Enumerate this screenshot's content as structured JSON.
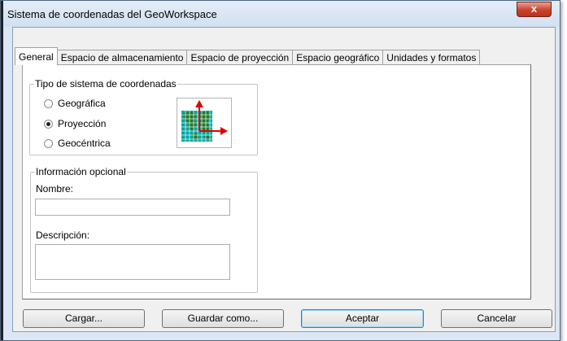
{
  "window": {
    "title": "Sistema de coordenadas del GeoWorkspace",
    "close_symbol": "x"
  },
  "tabs": [
    {
      "label": "General",
      "active": true
    },
    {
      "label": "Espacio de almacenamiento",
      "active": false
    },
    {
      "label": "Espacio de proyección",
      "active": false
    },
    {
      "label": "Espacio geográfico",
      "active": false
    },
    {
      "label": "Unidades y formatos",
      "active": false
    }
  ],
  "coordinate_type": {
    "label": "Tipo de sistema de coordenadas",
    "options": [
      {
        "label": "Geográfica",
        "checked": false
      },
      {
        "label": "Proyección",
        "checked": true
      },
      {
        "label": "Geocéntrica",
        "checked": false
      }
    ],
    "icon": "projection-map-icon"
  },
  "optional_info": {
    "label": "Información opcional",
    "name_label": "Nombre:",
    "name_value": "",
    "description_label": "Descripción:",
    "description_value": ""
  },
  "buttons": {
    "load": "Cargar...",
    "save_as": "Guardar como...",
    "accept": "Aceptar",
    "cancel": "Cancelar"
  },
  "colors": {
    "map_grid": "#00a6a6",
    "map_land": "#1f7a2a",
    "axis_arrow": "#e00000"
  }
}
